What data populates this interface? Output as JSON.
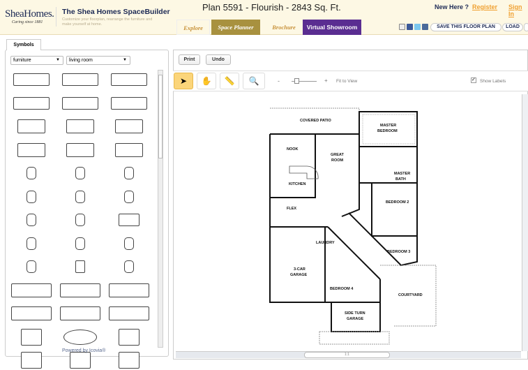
{
  "header": {
    "logo": "SheaHomes.",
    "logo_tagline": "Caring since 1881",
    "app_title": "The Shea Homes SpaceBuilder",
    "app_subtitle": "Customize your floorplan, rearrange the furniture and make yourself at home.",
    "plan_title": "Plan 5591 - Flourish - 2843 Sq. Ft.",
    "new_here": "New Here ?",
    "register": "Register",
    "sign_in": "Sign In",
    "tabs": [
      {
        "label": "Explore",
        "active": false
      },
      {
        "label": "Space Planner",
        "active": true
      },
      {
        "label": "Brochure",
        "active": false
      },
      {
        "label": "Virtual Showroom",
        "active": false
      }
    ],
    "save_label": "SAVE THIS FLOOR PLAN",
    "load_label": "LOAD",
    "social_icons": [
      "email-icon",
      "facebook-icon",
      "twitter-icon",
      "share-icon"
    ],
    "colors": {
      "accent": "#a8913f",
      "showroom": "#5a2d91",
      "link": "#f0a030",
      "navy": "#1d2a55"
    }
  },
  "symbols": {
    "tab": "Symbols",
    "category": "furniture",
    "room": "living room",
    "items": [
      "sofa",
      "sofa",
      "sofa",
      "sofa",
      "sofa",
      "sofa",
      "loveseat",
      "loveseat",
      "loveseat",
      "loveseat",
      "loveseat",
      "loveseat",
      "chair",
      "chair",
      "chair",
      "chair",
      "chair",
      "chair",
      "chair",
      "chair",
      "chaise",
      "chair",
      "chair",
      "chair",
      "chair",
      "ottoman",
      "chair",
      "entertainment-center",
      "bookshelf",
      "bench",
      "console-table",
      "console-table",
      "console-table",
      "coffee-table",
      "oval-table",
      "square-table",
      "end-table",
      "corner-table",
      "sectional"
    ],
    "powered_by": "Powered by Icovia®"
  },
  "toolbar": {
    "print": "Print",
    "undo": "Undo",
    "fit": "Fit to View",
    "show_labels": "Show Labels",
    "show_labels_checked": true,
    "zoom_minus": "-",
    "zoom_plus": "+",
    "zoom_level": 0.1,
    "tools": [
      "select",
      "pan",
      "measure",
      "zoom"
    ],
    "active_tool": "select"
  },
  "floorplan": {
    "rooms": [
      "COVERED PATIO",
      "MASTER",
      "BEDROOM",
      "NOOK",
      "GREAT",
      "ROOM",
      "KITCHEN",
      "MASTER",
      "BATH",
      "FLEX",
      "BEDROOM 2",
      "LAUNDRY",
      "BEDROOM 3",
      "3-CAR",
      "GARAGE",
      "BEDROOM 4",
      "COURTYARD",
      "SIDE TURN",
      "GARAGE"
    ]
  },
  "hscroll_label": "1:1"
}
